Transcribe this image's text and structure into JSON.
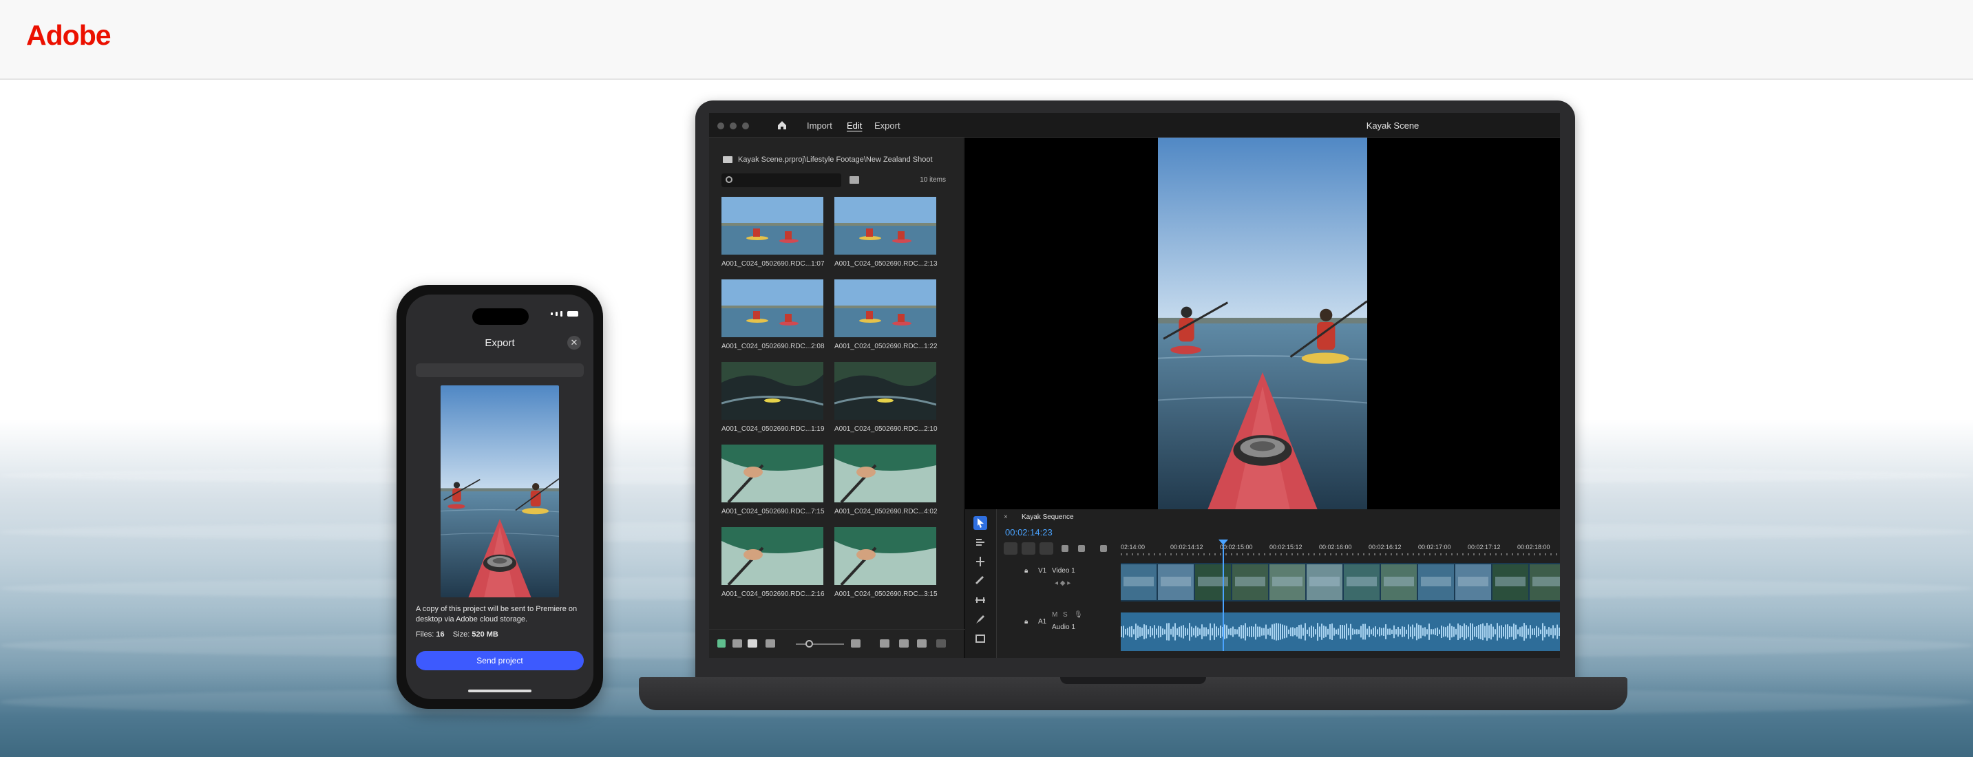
{
  "header": {
    "logo_text": "Adobe"
  },
  "colors": {
    "adobe_red": "#eb1000",
    "send_button": "#3d5afe",
    "timecode_blue": "#4aa3ff",
    "tool_selected": "#2f6fe0"
  },
  "phone": {
    "title": "Export",
    "close_icon": "close-icon",
    "description": "A copy of this project will be sent to Premiere on desktop via Adobe cloud storage.",
    "files_label": "Files:",
    "files_value": "16",
    "size_label": "Size:",
    "size_value": "520 MB",
    "send_button_label": "Send project"
  },
  "app": {
    "menu": {
      "import": "Import",
      "edit": "Edit",
      "export": "Export"
    },
    "project_title": "Kayak Scene",
    "project_panel": {
      "breadcrumb": "Kayak Scene.prproj\\Lifestyle Footage\\New Zealand Shoot",
      "item_count": "10 items",
      "clips": [
        {
          "name": "A001_C024_0502690.RDC...",
          "duration": "1:07"
        },
        {
          "name": "A001_C024_0502690.RDC...",
          "duration": "2:13"
        },
        {
          "name": "A001_C024_0502690.RDC...",
          "duration": "2:08"
        },
        {
          "name": "A001_C024_0502690.RDC...",
          "duration": "1:22"
        },
        {
          "name": "A001_C024_0502690.RDC...",
          "duration": "1:19"
        },
        {
          "name": "A001_C024_0502690.RDC...",
          "duration": "2:10"
        },
        {
          "name": "A001_C024_0502690.RDC...",
          "duration": "7:15"
        },
        {
          "name": "A001_C024_0502690.RDC...",
          "duration": "4:02"
        },
        {
          "name": "A001_C024_0502690.RDC...",
          "duration": "2:16"
        },
        {
          "name": "A001_C024_0502690.RDC...",
          "duration": "3:15"
        }
      ]
    },
    "timeline": {
      "sequence_name": "Kayak Sequence",
      "timecode": "00:02:14:23",
      "ruler": [
        "02:14:00",
        "00:02:14:12",
        "00:02:15:00",
        "00:02:15:12",
        "00:02:16:00",
        "00:02:16:12",
        "00:02:17:00",
        "00:02:17:12",
        "00:02:18:00"
      ],
      "video_track": {
        "id": "V1",
        "name": "Video 1"
      },
      "audio_track": {
        "id": "A1",
        "name": "Audio 1"
      }
    }
  }
}
